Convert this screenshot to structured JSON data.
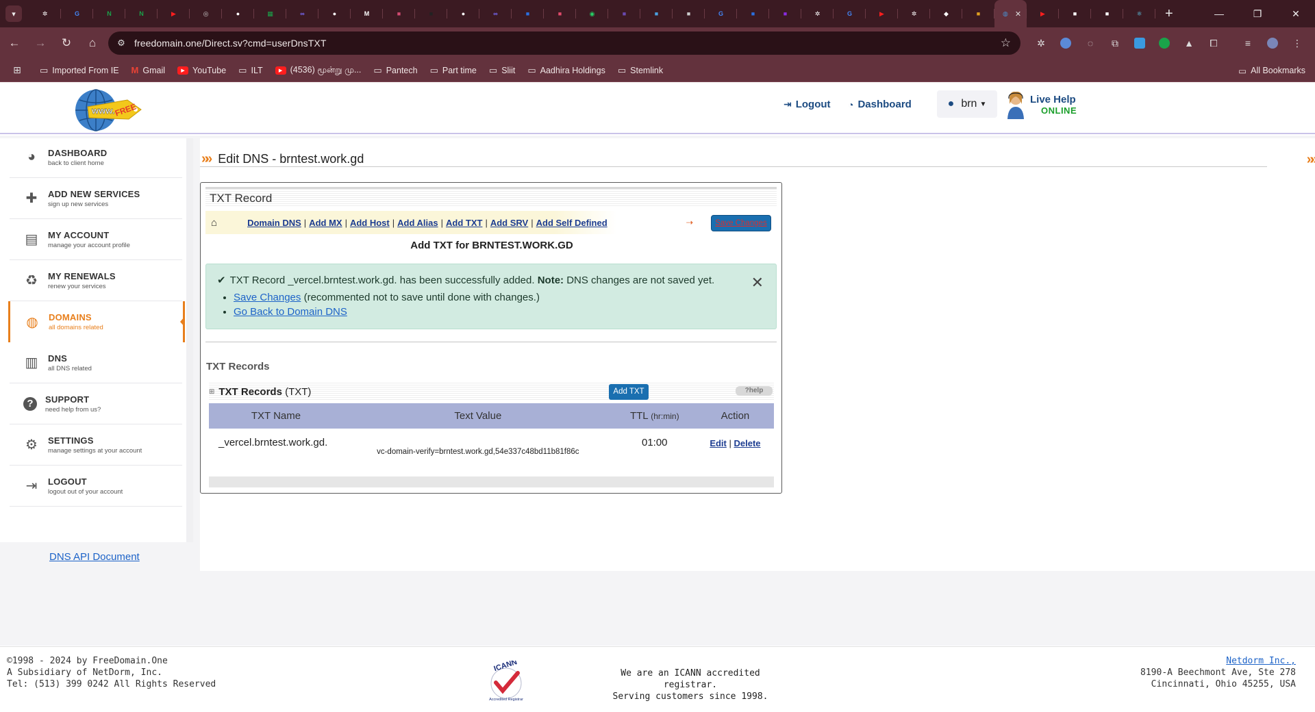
{
  "browser": {
    "tabs": [
      {
        "icon": "chatgpt-icon",
        "color": "#ffffff"
      },
      {
        "icon": "google-icon",
        "color": "#4285f4"
      },
      {
        "icon": "n-icon",
        "color": "#1aa34a"
      },
      {
        "icon": "n-icon",
        "color": "#1aa34a"
      },
      {
        "icon": "youtube-icon",
        "color": "#ff1e1e"
      },
      {
        "icon": "globe-icon",
        "color": "#cccccc"
      },
      {
        "icon": "github-icon",
        "color": "#ffffff"
      },
      {
        "icon": "sheets-icon",
        "color": "#1aa34a"
      },
      {
        "icon": "meta-icon",
        "color": "#7a6cff"
      },
      {
        "icon": "github-icon",
        "color": "#ffffff"
      },
      {
        "icon": "medium-icon",
        "color": "#ffffff"
      },
      {
        "icon": "app-icon",
        "color": "#d04a70"
      },
      {
        "icon": "app-icon",
        "color": "#222222"
      },
      {
        "icon": "github-icon",
        "color": "#ffffff"
      },
      {
        "icon": "meta-icon",
        "color": "#7a6cff"
      },
      {
        "icon": "app-icon",
        "color": "#2a6fe0"
      },
      {
        "icon": "app-icon",
        "color": "#e04a6a"
      },
      {
        "icon": "whatsapp-icon",
        "color": "#25d366"
      },
      {
        "icon": "app-icon",
        "color": "#6a4ab0"
      },
      {
        "icon": "app-icon",
        "color": "#4aa0e0"
      },
      {
        "icon": "app-icon",
        "color": "#cccccc"
      },
      {
        "icon": "google-icon",
        "color": "#4285f4"
      },
      {
        "icon": "app-icon",
        "color": "#2a6fe0"
      },
      {
        "icon": "app-icon",
        "color": "#8a2be2"
      },
      {
        "icon": "chatgpt-icon",
        "color": "#ffffff"
      },
      {
        "icon": "google-icon",
        "color": "#4285f4"
      },
      {
        "icon": "youtube-icon",
        "color": "#ff1e1e"
      },
      {
        "icon": "chatgpt-icon",
        "color": "#ffffff"
      },
      {
        "icon": "openai-icon",
        "color": "#ffffff"
      },
      {
        "icon": "app-icon",
        "color": "#e0a020"
      },
      {
        "icon": "freedomain-icon",
        "color": "#4a90d0",
        "active": true
      },
      {
        "icon": "youtube-icon",
        "color": "#ff1e1e"
      },
      {
        "icon": "app-icon",
        "color": "#ffffff"
      },
      {
        "icon": "app-icon",
        "color": "#ffffff"
      },
      {
        "icon": "react-icon",
        "color": "#61dafb"
      }
    ],
    "url": "freedomain.one/Direct.sv?cmd=userDnsTXT",
    "bookmarks": [
      {
        "label": "Imported From IE",
        "icon": "folder-icon"
      },
      {
        "label": "Gmail",
        "icon": "gmail-icon"
      },
      {
        "label": "YouTube",
        "icon": "youtube-icon"
      },
      {
        "label": "ILT",
        "icon": "folder-icon"
      },
      {
        "label": "(4536) மூன்று மு...",
        "icon": "youtube-icon"
      },
      {
        "label": "Pantech",
        "icon": "folder-icon"
      },
      {
        "label": "Part time",
        "icon": "folder-icon"
      },
      {
        "label": "Sliit",
        "icon": "folder-icon"
      },
      {
        "label": "Aadhira Holdings",
        "icon": "folder-icon"
      },
      {
        "label": "Stemlink",
        "icon": "folder-icon"
      }
    ],
    "all_bookmarks": "All Bookmarks"
  },
  "header": {
    "logout": "Logout",
    "dashboard": "Dashboard",
    "user": "brn",
    "live_help": "Live Help",
    "online": "ONLINE",
    "logo_text": "www. FREE"
  },
  "sidebar": {
    "items": [
      {
        "title": "DASHBOARD",
        "sub": "back to client home",
        "icon": "dashboard-icon"
      },
      {
        "title": "ADD NEW SERVICES",
        "sub": "sign up new services",
        "icon": "plus-icon"
      },
      {
        "title": "MY ACCOUNT",
        "sub": "manage your account profile",
        "icon": "account-card-icon"
      },
      {
        "title": "MY RENEWALS",
        "sub": "renew your services",
        "icon": "recycle-icon"
      },
      {
        "title": "DOMAINS",
        "sub": "all domains related",
        "icon": "globe-icon",
        "active": true
      },
      {
        "title": "DNS",
        "sub": "all DNS related",
        "icon": "dns-server-icon"
      },
      {
        "title": "SUPPORT",
        "sub": "need help from us?",
        "icon": "question-icon"
      },
      {
        "title": "SETTINGS",
        "sub": "manage settings at your account",
        "icon": "gears-icon"
      },
      {
        "title": "LOGOUT",
        "sub": "logout out of your account",
        "icon": "logout-icon"
      }
    ],
    "api_doc": "DNS API Document",
    "accent_color": "#e87f1c"
  },
  "main": {
    "title": "Edit DNS - brntest.work.gd",
    "box_title": "TXT Record",
    "nav": {
      "links": [
        "Domain DNS",
        "Add MX",
        "Add Host",
        "Add Alias",
        "Add TXT",
        "Add SRV",
        "Add Self Defined"
      ],
      "save_changes": "Save Changes"
    },
    "add_heading": "Add TXT for BRNTEST.WORK.GD",
    "alert": {
      "message": "TXT Record _vercel.brntest.work.gd. has been successfully added.",
      "note_label": "Note:",
      "note_text": "DNS changes are not saved yet.",
      "save_link": "Save Changes",
      "save_suffix": "(recommented not to save until done with changes.)",
      "back_link": "Go Back to Domain DNS"
    },
    "txt_heading": "TXT Records",
    "records_bar": {
      "label": "TXT Records",
      "suffix": "(TXT)",
      "add_button": "Add TXT",
      "help": "help"
    },
    "table": {
      "headers": {
        "name": "TXT Name",
        "value": "Text Value",
        "ttl": "TTL",
        "ttl_unit": "(hr:min)",
        "action": "Action"
      },
      "rows": [
        {
          "name": "_vercel.brntest.work.gd.",
          "value": "vc-domain-verify=brntest.work.gd,54e337c48bd11b81f86c",
          "ttl": "01:00",
          "edit": "Edit",
          "delete": "Delete"
        }
      ]
    }
  },
  "footer": {
    "left": [
      "©1998 - 2024 by FreeDomain.One",
      "A Subsidiary of NetDorm, Inc.",
      "Tel: (513) 399 0242 All Rights Reserved"
    ],
    "center": [
      "We are an ICANN accredited registrar.",
      "Serving customers since 1998."
    ],
    "icann_text": "ICANN",
    "icann_sub": "Accredited Registrar",
    "right_link": "Netdorm Inc.,",
    "right": [
      "8190-A Beechmont Ave, Ste 278",
      "Cincinnati, Ohio 45255, USA"
    ]
  }
}
